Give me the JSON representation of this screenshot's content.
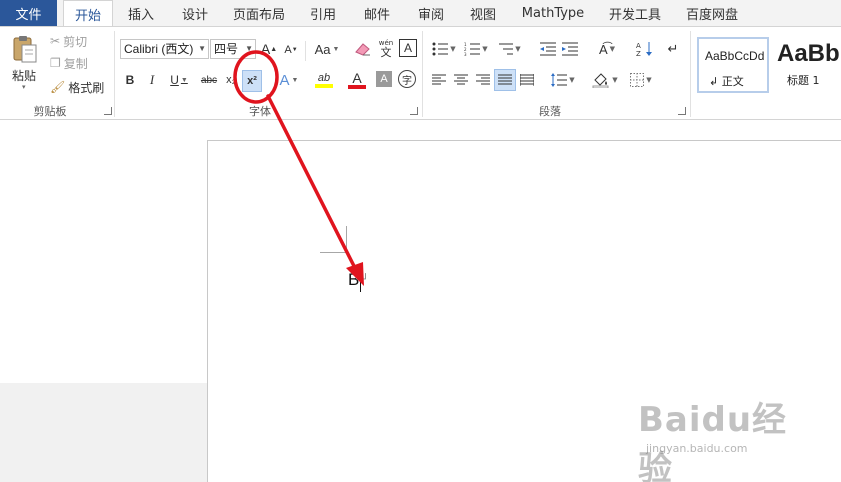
{
  "tabs": {
    "file": "文件",
    "items": [
      "开始",
      "插入",
      "设计",
      "页面布局",
      "引用",
      "邮件",
      "审阅",
      "视图",
      "MathType",
      "开发工具",
      "百度网盘"
    ],
    "active": "开始"
  },
  "clipboard": {
    "paste": "粘贴",
    "cut": "剪切",
    "copy": "复制",
    "format_painter": "格式刷",
    "group": "剪贴板"
  },
  "font": {
    "name": "Calibri (西文)",
    "size": "四号",
    "grow": "A",
    "shrink": "A",
    "change_case": "Aa",
    "phonetic_top": "wén",
    "phonetic_bottom": "文",
    "border_char": "A",
    "bold": "B",
    "italic": "I",
    "underline": "U",
    "strike": "abc",
    "subscript": "x₂",
    "superscript": "x²",
    "text_effect": "A",
    "highlight": "ab",
    "font_color": "A",
    "shade": "A",
    "enclose": "字",
    "group": "字体"
  },
  "paragraph": {
    "group": "段落"
  },
  "styles": {
    "normal_preview": "AaBbCcDd",
    "normal": "↲ 正文",
    "heading_preview": "AaBb",
    "heading": "标题 1"
  },
  "document": {
    "text": "B",
    "para_mark": "↲"
  },
  "watermark": {
    "brand": "Baidu经验",
    "url": "jingyan.baidu.com"
  },
  "colors": {
    "accent": "#2b579a",
    "annotation": "#e0141e",
    "highlight": "#ffff00",
    "font_color": "#e0141e"
  },
  "icons": [
    "paste-icon",
    "scissors-icon",
    "copy-icon",
    "brush-icon",
    "eraser-icon",
    "bullets-icon",
    "numbering-icon",
    "multilevel-icon",
    "indent-icon",
    "sort-icon",
    "pilcrow-icon",
    "align-icon",
    "line-spacing-icon",
    "shading-icon",
    "borders-icon",
    "arrow-annotation",
    "circle-annotation"
  ]
}
